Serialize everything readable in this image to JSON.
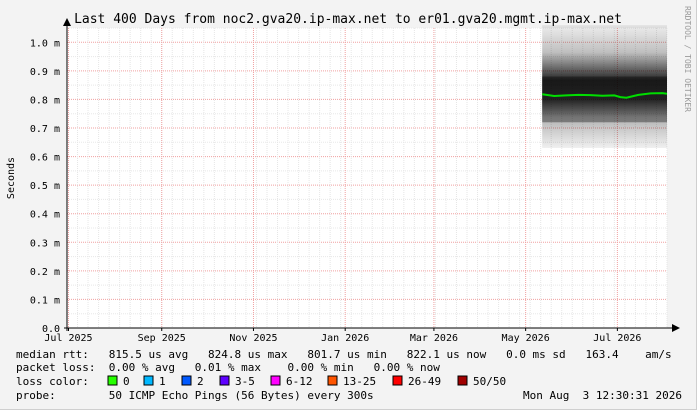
{
  "chart_data": {
    "type": "line",
    "title": "Last 400 Days from noc2.gva20.ip-max.net to er01.gva20.mgmt.ip-max.net",
    "ylabel": "Seconds",
    "credit": "RRDTOOL / TOBI OETIKER",
    "y_ticks": [
      "0.0",
      "0.1 m",
      "0.2 m",
      "0.3 m",
      "0.4 m",
      "0.5 m",
      "0.6 m",
      "0.7 m",
      "0.8 m",
      "0.9 m",
      "1.0 m"
    ],
    "ylim": [
      0,
      0.00105
    ],
    "x_ticks": [
      "Jul 2025",
      "Sep 2025",
      "Nov 2025",
      "Jan 2026",
      "Mar 2026",
      "May 2026",
      "Jul 2026"
    ],
    "x_tick_dates": [
      "2025-07-01",
      "2025-09-01",
      "2025-11-01",
      "2026-01-01",
      "2026-03-01",
      "2026-05-01",
      "2026-07-01"
    ],
    "xlim": [
      "2025-06-30",
      "2026-08-03"
    ],
    "grid": true,
    "smoke": {
      "start": "2026-05-12",
      "end": "2026-08-03",
      "min": 0.00063,
      "max": 0.00106,
      "dense_low": 0.00072,
      "dense_high": 0.00088
    },
    "series": [
      {
        "name": "median rtt",
        "color": "#00dd00",
        "x": [
          "2026-05-12",
          "2026-05-20",
          "2026-05-28",
          "2026-06-05",
          "2026-06-13",
          "2026-06-21",
          "2026-06-29",
          "2026-07-03",
          "2026-07-07",
          "2026-07-15",
          "2026-07-23",
          "2026-07-31",
          "2026-08-03"
        ],
        "y": [
          0.000818,
          0.000812,
          0.000814,
          0.000816,
          0.000815,
          0.000813,
          0.000814,
          0.000808,
          0.000806,
          0.000816,
          0.000821,
          0.000822,
          0.00082
        ]
      }
    ]
  },
  "stats": {
    "rtt_line": "median rtt:   815.5 us avg   824.8 us max   801.7 us min   822.1 us now   0.0 ms sd   163.4    am/s",
    "loss_line": "packet loss:  0.00 % avg   0.01 % max    0.00 % min   0.00 % now",
    "loss_color_label": "loss color:",
    "loss_colors": [
      {
        "label": "0",
        "color": "#26ff00"
      },
      {
        "label": "1",
        "color": "#00b8ff"
      },
      {
        "label": "2",
        "color": "#0059ff"
      },
      {
        "label": "3-5",
        "color": "#5e00ff"
      },
      {
        "label": "6-12",
        "color": "#ff00ff"
      },
      {
        "label": "13-25",
        "color": "#ff5500"
      },
      {
        "label": "26-49",
        "color": "#ff0000"
      },
      {
        "label": "50/50",
        "color": "#a10000"
      }
    ],
    "probe_line": "probe:        50 ICMP Echo Pings (56 Bytes) every 300s",
    "timestamp": "Mon Aug  3 12:30:31 2026"
  }
}
